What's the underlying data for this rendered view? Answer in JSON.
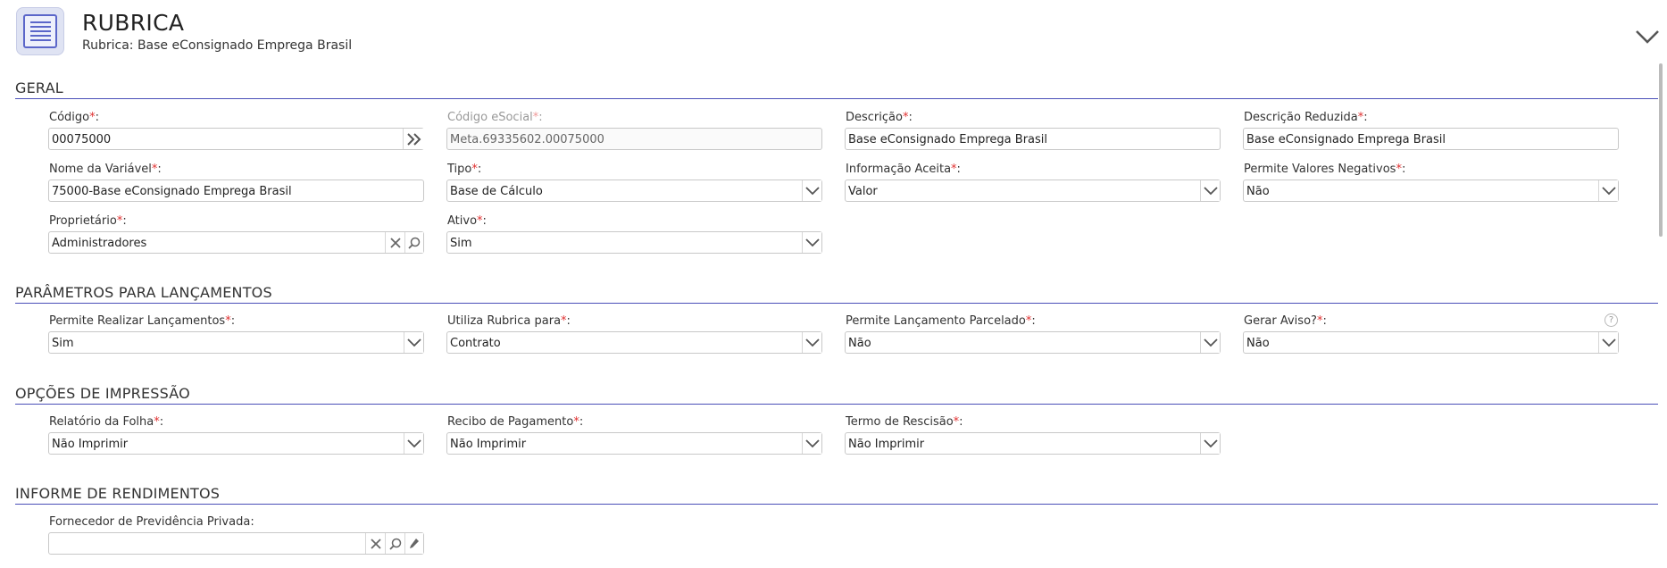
{
  "header": {
    "title": "RUBRICA",
    "subtitle": "Rubrica: Base eConsignado Emprega Brasil"
  },
  "sections": {
    "geral": "GERAL",
    "parametros": "PARÂMETROS PARA LANÇAMENTOS",
    "opcoes": "OPÇÕES DE IMPRESSÃO",
    "informe": "INFORME DE RENDIMENTOS"
  },
  "fields": {
    "codigo": {
      "label": "Código",
      "value": "00075000"
    },
    "codigo_esocial": {
      "label": "Código eSocial",
      "value": "Meta.69335602.00075000"
    },
    "descricao": {
      "label": "Descrição",
      "value": "Base eConsignado Emprega Brasil"
    },
    "descricao_reduzida": {
      "label": "Descrição Reduzida",
      "value": "Base eConsignado Emprega Brasil"
    },
    "nome_variavel": {
      "label": "Nome da Variável",
      "value": "75000-Base eConsignado Emprega Brasil"
    },
    "tipo": {
      "label": "Tipo",
      "value": "Base de Cálculo"
    },
    "informacao_aceita": {
      "label": "Informação Aceita",
      "value": "Valor"
    },
    "permite_valores_negativos": {
      "label": "Permite Valores Negativos",
      "value": "Não"
    },
    "proprietario": {
      "label": "Proprietário",
      "value": "Administradores"
    },
    "ativo": {
      "label": "Ativo",
      "value": "Sim"
    },
    "permite_realizar_lancamentos": {
      "label": "Permite Realizar Lançamentos",
      "value": "Sim"
    },
    "utiliza_rubrica_para": {
      "label": "Utiliza Rubrica para",
      "value": "Contrato"
    },
    "permite_lancamento_parcelado": {
      "label": "Permite Lançamento Parcelado",
      "value": "Não"
    },
    "gerar_aviso": {
      "label": "Gerar Aviso?",
      "value": "Não"
    },
    "relatorio_folha": {
      "label": "Relatório da Folha",
      "value": "Não Imprimir"
    },
    "recibo_pagamento": {
      "label": "Recibo de Pagamento",
      "value": "Não Imprimir"
    },
    "termo_rescisao": {
      "label": "Termo de Rescisão",
      "value": "Não Imprimir"
    },
    "fornecedor_previdencia": {
      "label": "Fornecedor de Previdência Privada",
      "value": ""
    }
  },
  "common": {
    "required_mark": "*",
    "colon": ":",
    "help_glyph": "?"
  },
  "colors": {
    "accent": "#4a4fb8",
    "required": "#e03030"
  }
}
